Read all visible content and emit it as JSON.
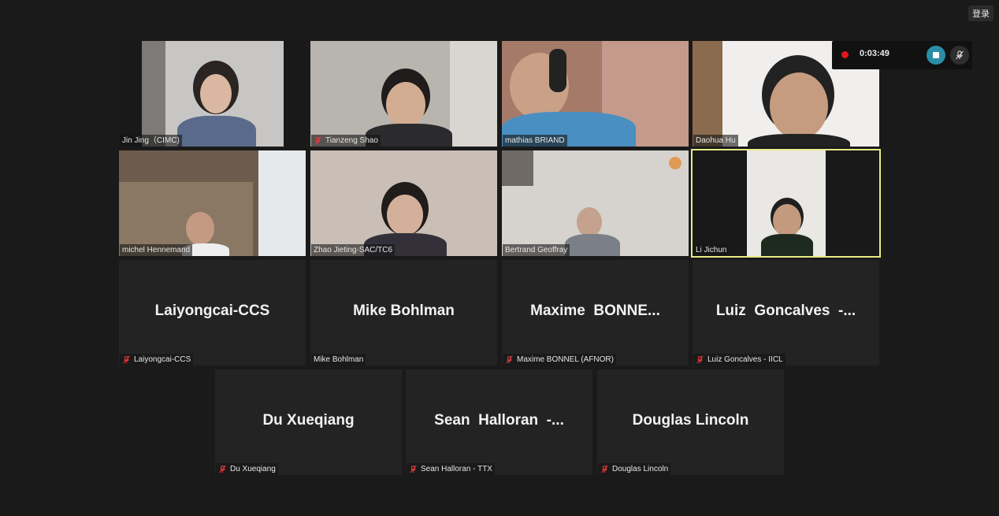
{
  "header": {
    "login_label": "登录"
  },
  "recording": {
    "time": "0:03:49"
  },
  "video_tiles": [
    {
      "name": "Jin Jing（CIMC)",
      "muted": false
    },
    {
      "name": "Tianzeng Shao",
      "muted": true
    },
    {
      "name": "mathias BRIAND",
      "muted": false
    },
    {
      "name": "Daohua Hu",
      "muted": false
    },
    {
      "name": "michel Hennemand",
      "muted": false
    },
    {
      "name": "Zhao Jieting-SAC/TC6",
      "muted": false
    },
    {
      "name": "Bertrand Geoffray",
      "muted": false
    },
    {
      "name": "Li Jichun",
      "muted": false
    }
  ],
  "avatar_tiles": [
    {
      "display": "Laiyongcai-CCS",
      "label": "Laiyongcai-CCS",
      "muted": true
    },
    {
      "display": "Mike Bohlman",
      "label": "Mike Bohlman",
      "muted": false
    },
    {
      "display": "Maxime  BONNE...",
      "label": "Maxime BONNEL (AFNOR)",
      "muted": true
    },
    {
      "display": "Luiz  Goncalves  -...",
      "label": "Luiz Goncalves - IICL",
      "muted": true
    },
    {
      "display": "Du Xueqiang",
      "label": "Du Xueqiang",
      "muted": true
    },
    {
      "display": "Sean  Halloran  -...",
      "label": "Sean Halloran - TTX",
      "muted": true
    },
    {
      "display": "Douglas Lincoln",
      "label": "Douglas Lincoln",
      "muted": true
    }
  ],
  "colors": {
    "muted_icon": "#e03a3a",
    "active_border": "#e6eb84",
    "record_dot": "#e0161d",
    "stop_button": "#2a8ea7"
  }
}
